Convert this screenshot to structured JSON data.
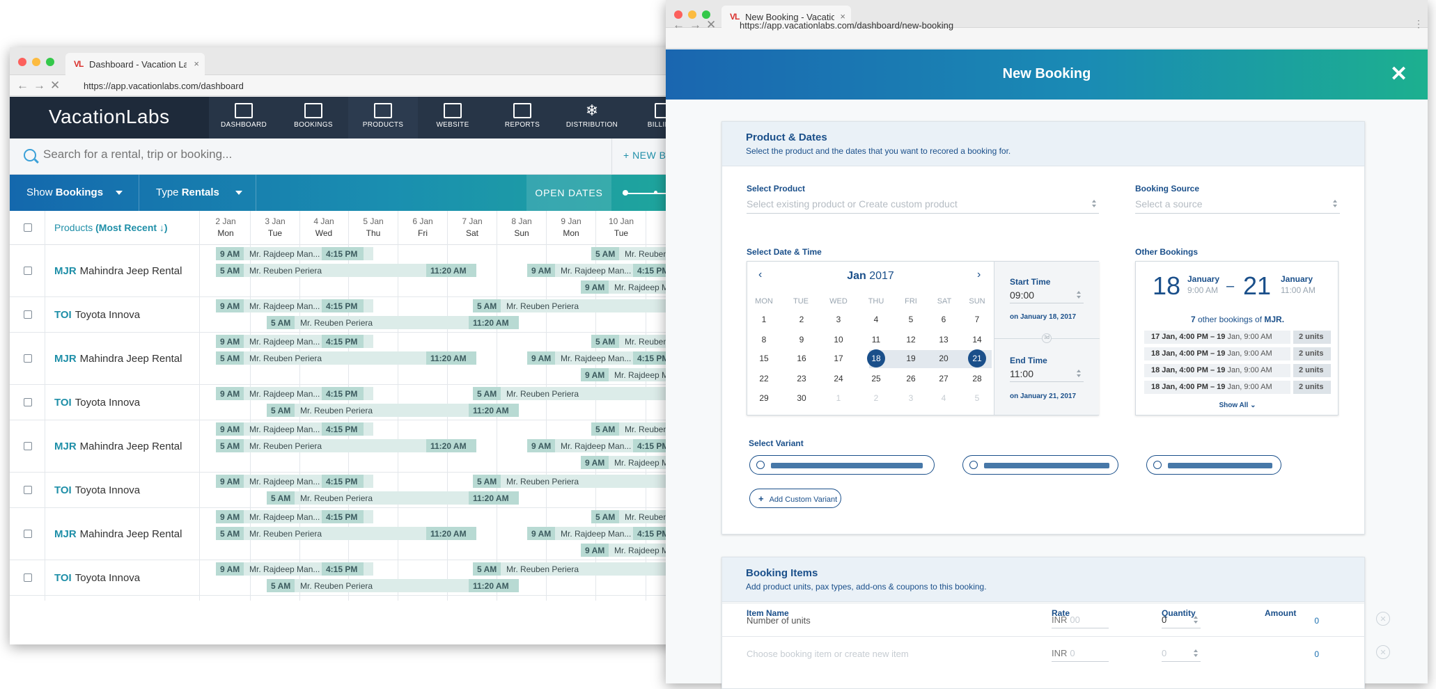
{
  "dashboard": {
    "tab_title": "Dashboard - Vacation Labs",
    "favicon": "VL",
    "url": "https://app.vacationlabs.com/dashboard",
    "logo": "VacationLabs",
    "nav": [
      "DASHBOARD",
      "BOOKINGS",
      "PRODUCTS",
      "WEBSITE",
      "REPORTS",
      "DISTRIBUTION",
      "BILLING"
    ],
    "search_placeholder": "Search for a rental, trip or booking...",
    "new_booking_label": "+ NEW BOOKING",
    "show_label": "Show",
    "show_value": "Bookings",
    "type_label": "Type",
    "type_value": "Rentals",
    "open_dates": "OPEN DATES",
    "products_header": "Products",
    "sort_label": "(Most Recent ↓)",
    "days": [
      {
        "date": "2 Jan",
        "dow": "Mon"
      },
      {
        "date": "3 Jan",
        "dow": "Tue"
      },
      {
        "date": "4 Jan",
        "dow": "Wed"
      },
      {
        "date": "5 Jan",
        "dow": "Thu"
      },
      {
        "date": "6 Jan",
        "dow": "Fri"
      },
      {
        "date": "7 Jan",
        "dow": "Sat"
      },
      {
        "date": "8 Jan",
        "dow": "Sun"
      },
      {
        "date": "9 Jan",
        "dow": "Mon"
      },
      {
        "date": "10 Jan",
        "dow": "Tue"
      }
    ],
    "products": [
      {
        "code": "MJR",
        "name": "Mahindra Jeep Rental"
      },
      {
        "code": "TOI",
        "name": "Toyota Innova"
      },
      {
        "code": "MJR",
        "name": "Mahindra Jeep Rental"
      },
      {
        "code": "TOI",
        "name": "Toyota Innova"
      },
      {
        "code": "MJR",
        "name": "Mahindra Jeep Rental"
      },
      {
        "code": "TOI",
        "name": "Toyota Innova"
      },
      {
        "code": "MJR",
        "name": "Mahindra Jeep Rental"
      },
      {
        "code": "TOI",
        "name": "Toyota Innova"
      }
    ],
    "booking_text": {
      "start": "9 AM",
      "start_5": "5 AM",
      "guest_rajdeep": "Mr. Rajdeep Man...",
      "guest_reuben": "Mr. Reuben Periera",
      "end_415": "4:15 PM",
      "end_1120": "11:20 AM"
    }
  },
  "new_booking": {
    "tab_title": "New Booking - Vacation Labs",
    "favicon": "VL",
    "url": "https://app.vacationlabs.com/dashboard/new-booking",
    "title": "New Booking",
    "product_dates": {
      "title": "Product & Dates",
      "subtitle": "Select the product and the dates that you want to recored a booking for.",
      "select_product_label": "Select Product",
      "select_product_placeholder": "Select existing product or Create custom product",
      "booking_source_label": "Booking Source",
      "booking_source_placeholder": "Select a source",
      "date_time_label": "Select Date & Time",
      "other_bookings_label": "Other Bookings"
    },
    "calendar": {
      "month": "Jan",
      "year": "2017",
      "weekdays": [
        "MON",
        "TUE",
        "WED",
        "THU",
        "FRI",
        "SAT",
        "SUN"
      ],
      "weeks": [
        [
          "1",
          "2",
          "3",
          "4",
          "5",
          "6",
          "7"
        ],
        [
          "8",
          "9",
          "10",
          "11",
          "12",
          "13",
          "14"
        ],
        [
          "15",
          "16",
          "17",
          "18",
          "19",
          "20",
          "21"
        ],
        [
          "22",
          "23",
          "24",
          "25",
          "26",
          "27",
          "28"
        ],
        [
          "29",
          "30",
          "1",
          "2",
          "3",
          "4",
          "5"
        ]
      ],
      "selected_start": 18,
      "selected_end": 21,
      "start_time_label": "Start Time",
      "start_time": "09:00",
      "start_on": "on January 18, 2017",
      "duration_badge": "3d",
      "end_time_label": "End Time",
      "end_time": "11:00",
      "end_on": "on January 21, 2017"
    },
    "other_bookings": {
      "from_day": "18",
      "from_month": "January",
      "from_time": "9:00 AM",
      "dash": "–",
      "to_day": "21",
      "to_month": "January",
      "to_time": "11:00 AM",
      "count_text_pre": "7",
      "count_text_mid": " other bookings of ",
      "count_text_code": "MJR.",
      "rows": [
        {
          "from": "17 Jan, 4:00 PM – ",
          "to_day": "19",
          "to_rest": " Jan, 9:00 AM",
          "units": "2 units"
        },
        {
          "from": "18 Jan, 4:00 PM – ",
          "to_day": "19",
          "to_rest": " Jan, 9:00 AM",
          "units": "2 units"
        },
        {
          "from": "18 Jan, 4:00 PM – ",
          "to_day": "19",
          "to_rest": " Jan, 9:00 AM",
          "units": "2 units"
        },
        {
          "from": "18 Jan, 4:00 PM – ",
          "to_day": "19",
          "to_rest": " Jan, 9:00 AM",
          "units": "2 units"
        }
      ],
      "show_all": "Show All ⌄"
    },
    "variant": {
      "label": "Select Variant",
      "add_custom": "Add Custom Variant"
    },
    "booking_items": {
      "title": "Booking Items",
      "subtitle": "Add product units, pax types, add-ons & coupons to this booking.",
      "col_item": "Item Name",
      "col_rate": "Rate",
      "col_qty": "Quantity",
      "col_amount": "Amount",
      "rows": [
        {
          "name": "Number of units",
          "currency": "INR",
          "rate": "00",
          "qty": "0",
          "amount": "0"
        },
        {
          "name": "Choose booking item or create new item",
          "currency": "INR",
          "rate": "0",
          "qty": "0",
          "amount": "0"
        }
      ]
    }
  },
  "colors": {
    "brand_dark": "#1e2a3a",
    "accent_blue": "#1a4f8a",
    "teal": "#1fa89a",
    "booking_bar": "#dcece9"
  }
}
